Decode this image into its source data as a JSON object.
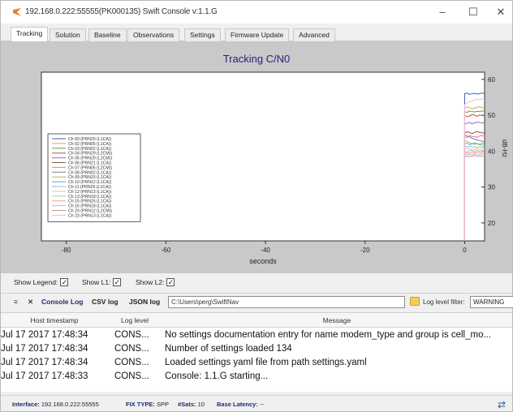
{
  "window": {
    "title": "192.168.0.222:55555(PK000135) Swift Console v:1.1.G",
    "minimize": "–",
    "maximize": "☐",
    "close": "✕"
  },
  "tabs": [
    "Tracking",
    "Solution",
    "Baseline",
    "Observations",
    "Settings",
    "Firmware Update",
    "Advanced"
  ],
  "active_tab": "Tracking",
  "chart_data": {
    "type": "line",
    "title": "Tracking C/N0",
    "xlabel": "seconds",
    "ylabel": "dB-Hz",
    "xlim": [
      -85,
      4
    ],
    "ylim": [
      15,
      62
    ],
    "x_ticks": [
      -80,
      -60,
      -40,
      -20,
      0
    ],
    "y_ticks": [
      20,
      30,
      40,
      50,
      60
    ],
    "legend_position": "left",
    "legend": [
      "Ch 00 (PRN29 (L1CA))",
      "Ch 02 (PRN05 (L1CA))",
      "Ch 03 (PRN02 (L1CA))",
      "Ch 04 (PRN29 (L2CM))",
      "Ch 05 (PRN29 (L2CM))",
      "Ch 06 (PRN21 (L1CA))",
      "Ch 07 (PRN05 (L2CM))",
      "Ch 08 (PRN02 (L1CA))",
      "Ch 09 (PRN15 (L1CA))",
      "Ch 10 (PRN12 (L1CA))",
      "Ch 11 (PRN29 (L1CA))",
      "Ch 12 (PRN13 (L1CA))",
      "Ch 13 (PRN18 (L1CA))",
      "Ch 15 (PRN25 (L1CA))",
      "Ch 16 (PRN18 (L1CA))",
      "Ch 20 (PRN12 (L2CM))",
      "Ch 23 (PRN13 (L1CA))"
    ],
    "series_colors": [
      "#3b5cc9",
      "#e8a040",
      "#4aa84a",
      "#d04848",
      "#9a6ac8",
      "#8c5a3a",
      "#e07ac0",
      "#808080",
      "#b8b83a",
      "#3ab8c8",
      "#9db3e8",
      "#f2c08a",
      "#9ed39e",
      "#f19a9a",
      "#c9b0e0",
      "#c59a8a",
      "#f2b6d8"
    ],
    "x": [
      0,
      0.5,
      1,
      1.5,
      2,
      2.5,
      3,
      3.5,
      4
    ],
    "series": [
      {
        "values": [
          56,
          56.2,
          55.8,
          56,
          56.1,
          55.9,
          56,
          56.2,
          56
        ]
      },
      {
        "values": [
          52,
          52.3,
          52.1,
          51.8,
          52,
          52.2,
          52.4,
          52.1,
          52
        ]
      },
      {
        "values": [
          51,
          50.8,
          51.2,
          51,
          50.9,
          51.1,
          51,
          51.2,
          51
        ]
      },
      {
        "values": [
          50,
          49.6,
          49.8,
          50.2,
          50,
          49.7,
          50.1,
          49.9,
          50
        ]
      },
      {
        "values": [
          47.5,
          47.8,
          48,
          47.6,
          47.9,
          48.1,
          48,
          47.8,
          48
        ]
      },
      {
        "values": [
          45,
          45.4,
          45.2,
          44.9,
          45.3,
          45.5,
          45.2,
          45.1,
          45
        ]
      },
      {
        "values": [
          44,
          43.8,
          44.3,
          44.1,
          44,
          43.9,
          44.2,
          44.4,
          44
        ]
      },
      {
        "values": [
          44.5,
          44.2,
          44,
          43.6,
          43.3,
          43.1,
          42.9,
          42.8,
          42.5
        ]
      },
      {
        "values": [
          43,
          42.6,
          42.3,
          42.1,
          41.9,
          42,
          41.8,
          41.7,
          41.5
        ]
      },
      {
        "values": [
          42,
          42.2,
          41.8,
          42,
          42.3,
          42.1,
          41.9,
          42.2,
          42
        ]
      },
      {
        "values": [
          41.5,
          41.2,
          41.4,
          41.1,
          41.3,
          41,
          41.2,
          41.1,
          41
        ]
      },
      {
        "values": [
          40.5,
          40.8,
          40.6,
          40.3,
          40.5,
          40.7,
          40.4,
          40.6,
          40.5
        ]
      },
      {
        "values": [
          40,
          39.8,
          40.2,
          40.1,
          39.9,
          40.2,
          40,
          40.1,
          40
        ]
      },
      {
        "values": [
          39.5,
          39.6,
          39.4,
          39.7,
          39.5,
          39.8,
          39.6,
          39.5,
          39.5
        ]
      },
      {
        "values": [
          39,
          39.2,
          39.1,
          38.9,
          39.3,
          39.1,
          39,
          39.2,
          39
        ]
      },
      {
        "values": [
          38.5,
          38.7,
          38.4,
          38.6,
          38.8,
          38.5,
          38.7,
          38.6,
          38.5
        ]
      },
      {
        "values": [
          53,
          53.4,
          53.8,
          54,
          54.2,
          54.5,
          54.3,
          54.6,
          54.8
        ]
      }
    ]
  },
  "checkboxes": [
    {
      "label": "Show Legend:",
      "checked": true
    },
    {
      "label": "Show L1:",
      "checked": true
    },
    {
      "label": "Show L2:",
      "checked": true
    }
  ],
  "log_toolbar": {
    "console_log": "Console Log",
    "csv_log": "CSV log",
    "json_log": "JSON log",
    "path": "C:\\Users\\perg\\SwiftNav",
    "filter_label": "Log level filter:",
    "filter_value": "WARNING"
  },
  "log_table": {
    "headers": [
      "Host timestamp",
      "Log level",
      "Message"
    ],
    "rows": [
      [
        "Jul 17 2017 17:48:34",
        "CONS...",
        "No settings documentation entry for name modem_type and group is cell_mo..."
      ],
      [
        "Jul 17 2017 17:48:34",
        "CONS...",
        "Number of settings loaded 134"
      ],
      [
        "Jul 17 2017 17:48:34",
        "CONS...",
        "Loaded settings yaml file from path settings.yaml"
      ],
      [
        "Jul 17 2017 17:48:33",
        "CONS...",
        "Console: 1.1.G starting..."
      ]
    ]
  },
  "statusbar": {
    "interface_label": "Interface:",
    "interface_value": "192.168.0.222:55555",
    "fix_label": "FIX TYPE:",
    "fix_value": "SPP",
    "sats_label": "#Sats:",
    "sats_value": "10",
    "latency_label": "Base Latency:",
    "latency_value": "--"
  },
  "colors": {
    "plot_background": "#c9c9c9",
    "axes_background": "#ffffff",
    "title_color": "#24247a"
  },
  "icons": {
    "app": "swift-logo-icon",
    "console_close": "close-icon",
    "console_menu": "menu-icon",
    "folder": "folder-icon",
    "refresh": "refresh-icon"
  }
}
